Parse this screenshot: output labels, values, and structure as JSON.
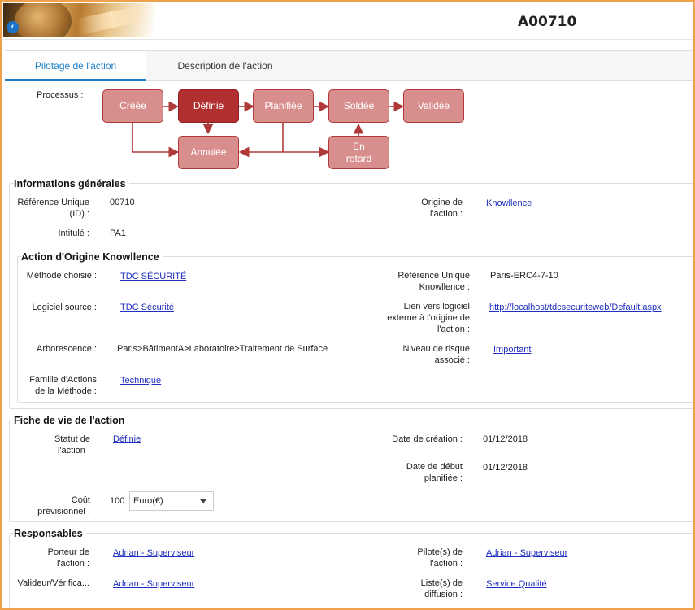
{
  "header": {
    "code": "A00710"
  },
  "tabs": [
    {
      "label": "Pilotage de l'action",
      "active": true
    },
    {
      "label": "Description de l'action",
      "active": false
    }
  ],
  "process": {
    "label": "Processus :",
    "nodes": {
      "creee": "Créée",
      "definie": "Définie",
      "planifiee": "Planifiée",
      "soldee": "Soldée",
      "validee": "Validée",
      "annulee": "Annulée",
      "en_retard_1": "En",
      "en_retard_2": "retard"
    },
    "active_node": "Définie"
  },
  "info_generales": {
    "title": "Informations générales",
    "ref_label": "Référence Unique (ID) :",
    "ref_value": "00710",
    "intitule_label": "Intitulé :",
    "intitule_value": "PA1",
    "origine_label": "Origine de l'action :",
    "origine_value": "Knowllence"
  },
  "action_origine": {
    "title": "Action d'Origine Knowllence",
    "methode_label": "Méthode choisie :",
    "methode_value": "TDC SÉCURITÉ",
    "logiciel_label": "Logiciel source :",
    "logiciel_value": "TDC Sécurité",
    "arbo_label": "Arborescence :",
    "arbo_value": "Paris>BâtimentA>Laboratoire>Traitement de Surface",
    "famille_label": "Famille d'Actions de la Méthode :",
    "famille_value": "Technique",
    "ref_k_label": "Référence Unique Knowllence :",
    "ref_k_value": "Paris-ERC4-7-10",
    "lien_label": "Lien vers logiciel externe à l'origine de l'action :",
    "lien_value": "http://localhost/tdcsecuriteweb/Default.aspx",
    "risque_label": "Niveau de risque associé :",
    "risque_value": "Important"
  },
  "fiche_vie": {
    "title": "Fiche de vie de l'action",
    "statut_label": "Statut de l'action :",
    "statut_value": "Définie",
    "creation_label": "Date de création :",
    "creation_value": "01/12/2018",
    "debut_label": "Date de début planifiée :",
    "debut_value": "01/12/2018",
    "cout_label": "Coût prévisionnel :",
    "cout_value": "100",
    "devise_value": "Euro(€)"
  },
  "responsables": {
    "title": "Responsables",
    "porteur_label": "Porteur de l'action :",
    "porteur_value": "Adrian - Superviseur",
    "valideur_label": "Valideur/Vérifica...",
    "valideur_value": "Adrian - Superviseur",
    "pilote_label": "Pilote(s) de l'action :",
    "pilote_value": "Adrian - Superviseur",
    "liste_label": "Liste(s) de diffusion :",
    "liste_value": "Service Qualité"
  },
  "colors": {
    "accent": "#1f7fc4",
    "node": "#d98e8e",
    "node_active": "#b22f2f",
    "frame": "#f0a04b",
    "link": "#1f2fc0"
  }
}
